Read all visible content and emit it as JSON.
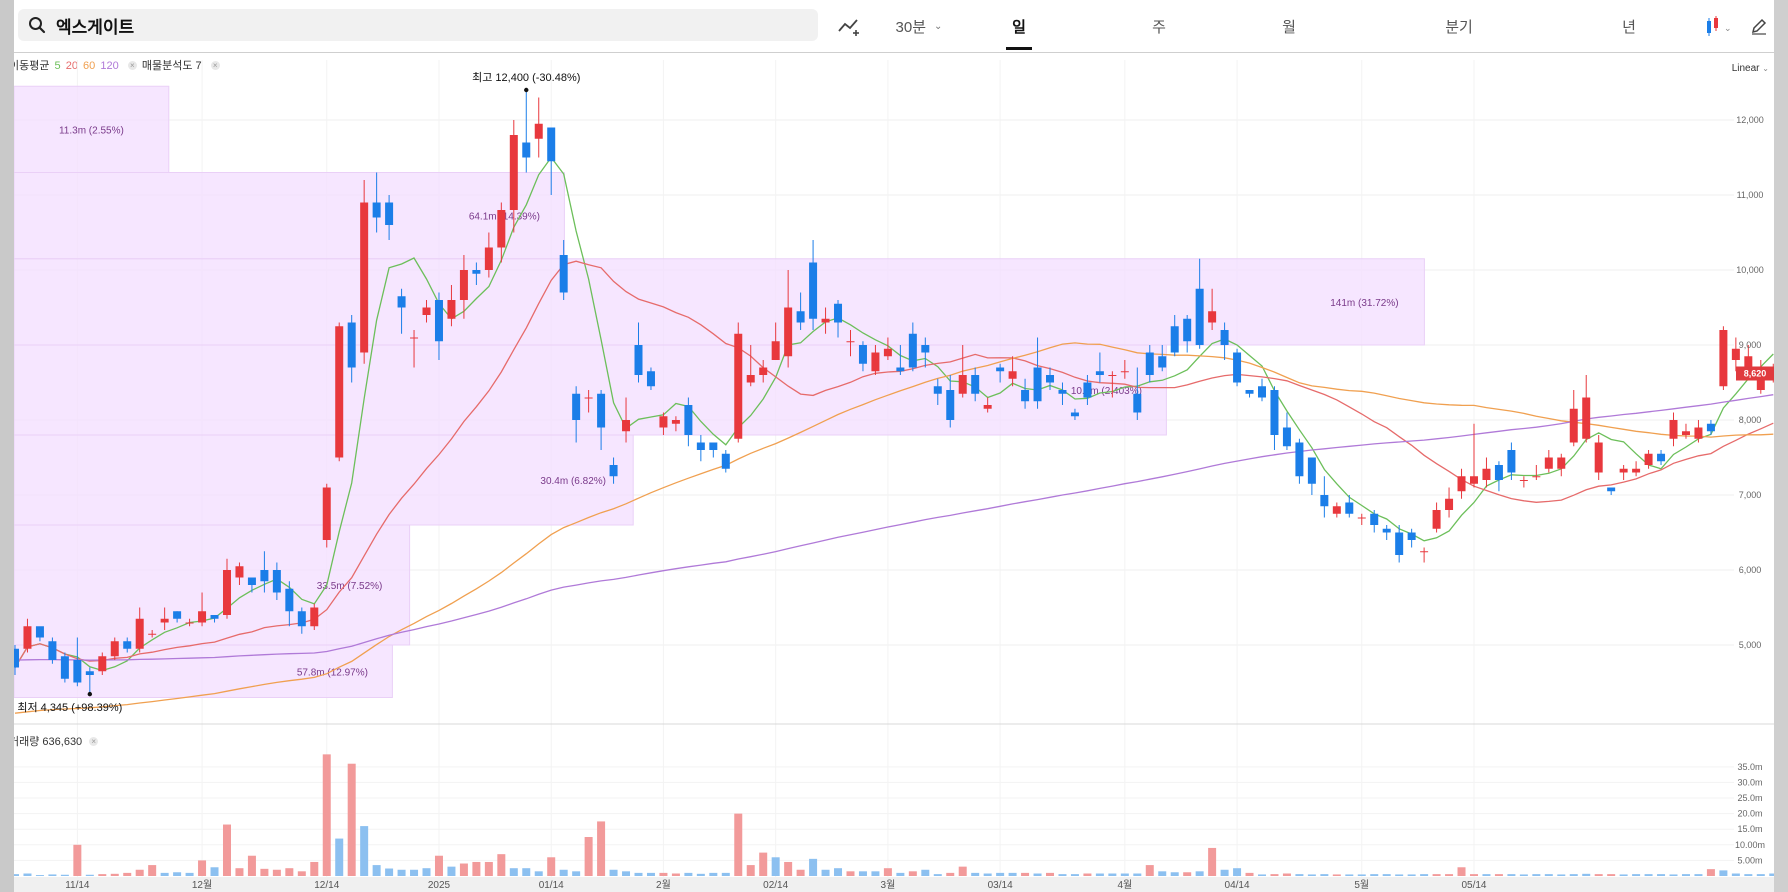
{
  "search": {
    "value": "엑스게이트"
  },
  "toolbar": {
    "interval_label": "30분",
    "tabs": [
      {
        "label": "일",
        "active": true
      },
      {
        "label": "주",
        "active": false
      },
      {
        "label": "월",
        "active": false
      },
      {
        "label": "분기",
        "active": false
      },
      {
        "label": "년",
        "active": false
      }
    ],
    "icons": [
      "search-icon",
      "indicator-icon",
      "candle-type-icon",
      "pencil-icon"
    ]
  },
  "legend": {
    "ma_label": "이동평균",
    "ma_periods": [
      "5",
      "20",
      "60",
      "120"
    ],
    "ma_colors": [
      "#6cbf5a",
      "#e66b6b",
      "#f0a050",
      "#b07ad8"
    ],
    "profile_label": "매물분석도 7"
  },
  "scale_mode": "Linear",
  "price_annotations": {
    "high": {
      "prefix": "최고",
      "value": "12,400",
      "pct": "(-30.48%)"
    },
    "low": {
      "prefix": "최저",
      "value": "4,345",
      "pct": "(+98.39%)"
    },
    "current": "8,620"
  },
  "volume_label": "거래량 636,630",
  "colors": {
    "up": "#e8383d",
    "down": "#1b7ee8",
    "up_vol": "#f29a9a",
    "down_vol": "#8cc0f0",
    "profile": "#f3deff",
    "current_tag": "#e03a3e"
  },
  "chart_data": {
    "type": "candlestick",
    "price_axis": {
      "ticks": [
        "5,000",
        "6,000",
        "7,000",
        "8,000",
        "9,000",
        "10,000",
        "11,000",
        "12,000"
      ],
      "range": [
        4000,
        12800
      ]
    },
    "volume_axis": {
      "ticks": [
        "5.00m",
        "10.00m",
        "15.0m",
        "20.0m",
        "25.0m",
        "30.0m",
        "35.0m"
      ]
    },
    "x_labels": [
      "11/14",
      "12월",
      "12/14",
      "2025",
      "01/14",
      "2월",
      "02/14",
      "3월",
      "03/14",
      "4월",
      "04/14",
      "5월",
      "05/14"
    ],
    "volume_profile": [
      {
        "label": "57.8m (12.97%)",
        "low": 4300,
        "high": 5000,
        "reach": 0.22
      },
      {
        "label": "33.5m (7.52%)",
        "low": 5000,
        "high": 6600,
        "reach": 0.23
      },
      {
        "label": "30.4m (6.82%)",
        "low": 6600,
        "high": 7800,
        "reach": 0.36
      },
      {
        "label": "10.7m (2.403%)",
        "low": 7800,
        "high": 9000,
        "reach": 0.67
      },
      {
        "label": "141m (31.72%)",
        "low": 9000,
        "high": 10150,
        "reach": 0.82
      },
      {
        "label": "64.1m (14.39%)",
        "low": 10150,
        "high": 11300,
        "reach": 0.32
      },
      {
        "label": "11.3m (2.55%)",
        "low": 11300,
        "high": 12450,
        "reach": 0.09
      }
    ],
    "candles": [
      [
        4950,
        4700,
        5000,
        4600
      ],
      [
        4950,
        5250,
        5350,
        4900
      ],
      [
        5250,
        5100,
        5200,
        5050
      ],
      [
        5050,
        4800,
        5100,
        4750
      ],
      [
        4850,
        4550,
        4900,
        4500
      ],
      [
        4800,
        4500,
        5100,
        4450
      ],
      [
        4650,
        4600,
        4700,
        4345
      ],
      [
        4650,
        4850,
        4900,
        4600
      ],
      [
        4850,
        5050,
        5100,
        4800
      ],
      [
        5050,
        4950,
        5100,
        4900
      ],
      [
        4950,
        5350,
        5500,
        4900
      ],
      [
        5150,
        5150,
        5200,
        5100
      ],
      [
        5300,
        5350,
        5500,
        5200
      ],
      [
        5450,
        5350,
        5450,
        5300
      ],
      [
        5300,
        5300,
        5350,
        5250
      ],
      [
        5300,
        5450,
        5700,
        5250
      ],
      [
        5400,
        5350,
        5400,
        5300
      ],
      [
        5400,
        6000,
        6150,
        5350
      ],
      [
        5900,
        6050,
        6100,
        5800
      ],
      [
        5900,
        5800,
        5850,
        5700
      ],
      [
        6000,
        5850,
        6250,
        5700
      ],
      [
        6000,
        5700,
        6100,
        5600
      ],
      [
        5750,
        5450,
        5850,
        5250
      ],
      [
        5450,
        5250,
        5500,
        5150
      ],
      [
        5250,
        5500,
        5550,
        5200
      ],
      [
        6400,
        7100,
        7150,
        6300
      ],
      [
        7500,
        9250,
        9300,
        7450
      ],
      [
        9300,
        8700,
        9400,
        8500
      ],
      [
        8900,
        10900,
        11200,
        8750
      ],
      [
        10900,
        10700,
        11300,
        10500
      ],
      [
        10900,
        10600,
        11000,
        10400
      ],
      [
        9650,
        9500,
        9750,
        9150
      ],
      [
        9100,
        9100,
        9200,
        8700
      ],
      [
        9400,
        9500,
        9600,
        9300
      ],
      [
        9600,
        9050,
        9700,
        8800
      ],
      [
        9350,
        9600,
        9800,
        9250
      ],
      [
        9600,
        10000,
        10200,
        9350
      ],
      [
        10000,
        9950,
        10100,
        9800
      ],
      [
        10000,
        10300,
        10500,
        9900
      ],
      [
        10300,
        10800,
        10900,
        10100
      ],
      [
        10800,
        11800,
        12000,
        10500
      ],
      [
        11700,
        11500,
        12400,
        11300
      ],
      [
        11750,
        11950,
        12300,
        11500
      ],
      [
        11900,
        11450,
        11900,
        11000
      ],
      [
        10200,
        9700,
        10400,
        9600
      ],
      [
        8350,
        8000,
        8450,
        7700
      ],
      [
        8300,
        8300,
        8400,
        8100
      ],
      [
        8350,
        7900,
        8400,
        7600
      ],
      [
        7400,
        7250,
        7500,
        7150
      ],
      [
        7850,
        8000,
        8300,
        7700
      ],
      [
        9000,
        8600,
        9300,
        8500
      ],
      [
        8650,
        8450,
        8700,
        8400
      ],
      [
        7900,
        8050,
        8100,
        7800
      ],
      [
        7950,
        8000,
        8050,
        7850
      ],
      [
        8200,
        7800,
        8300,
        7650
      ],
      [
        7700,
        7600,
        7800,
        7450
      ],
      [
        7700,
        7600,
        7700,
        7500
      ],
      [
        7550,
        7350,
        7600,
        7300
      ],
      [
        7750,
        9150,
        9300,
        7700
      ],
      [
        8500,
        8600,
        9000,
        8450
      ],
      [
        8600,
        8700,
        8800,
        8500
      ],
      [
        8800,
        9050,
        9300,
        8800
      ],
      [
        8850,
        9500,
        10000,
        8700
      ],
      [
        9450,
        9300,
        9700,
        9200
      ],
      [
        10100,
        9350,
        10400,
        9200
      ],
      [
        9300,
        9350,
        9500,
        9150
      ],
      [
        9550,
        9300,
        9600,
        9100
      ],
      [
        9050,
        9050,
        9200,
        8850
      ],
      [
        9000,
        8750,
        9050,
        8650
      ],
      [
        8650,
        8900,
        9000,
        8600
      ],
      [
        8850,
        8950,
        9100,
        8800
      ],
      [
        8700,
        8650,
        9000,
        8600
      ],
      [
        9150,
        8700,
        9300,
        8650
      ],
      [
        9000,
        8900,
        9100,
        8700
      ],
      [
        8450,
        8350,
        8550,
        8200
      ],
      [
        8400,
        8000,
        8600,
        7900
      ],
      [
        8350,
        8600,
        9000,
        8300
      ],
      [
        8600,
        8350,
        8700,
        8250
      ],
      [
        8150,
        8200,
        8300,
        8100
      ],
      [
        8700,
        8650,
        8750,
        8500
      ],
      [
        8550,
        8650,
        8850,
        8450
      ],
      [
        8400,
        8250,
        8550,
        8150
      ],
      [
        8700,
        8250,
        9100,
        8150
      ],
      [
        8600,
        8500,
        8700,
        8400
      ],
      [
        8400,
        8350,
        8500,
        8200
      ],
      [
        8100,
        8050,
        8150,
        8000
      ],
      [
        8500,
        8300,
        8600,
        8200
      ],
      [
        8650,
        8600,
        8900,
        8500
      ],
      [
        8600,
        8600,
        8650,
        8300
      ],
      [
        8650,
        8650,
        8800,
        8550
      ],
      [
        8350,
        8100,
        8700,
        8000
      ],
      [
        8900,
        8600,
        9000,
        8500
      ],
      [
        8850,
        8700,
        9000,
        8650
      ],
      [
        9250,
        8900,
        9400,
        8850
      ],
      [
        9350,
        9050,
        9400,
        8900
      ],
      [
        9750,
        9000,
        10150,
        8950
      ],
      [
        9300,
        9450,
        9750,
        9200
      ],
      [
        9200,
        9000,
        9300,
        8800
      ],
      [
        8900,
        8500,
        8950,
        8450
      ],
      [
        8400,
        8350,
        8400,
        8300
      ],
      [
        8450,
        8300,
        8550,
        8250
      ],
      [
        8400,
        7800,
        8450,
        7600
      ],
      [
        7900,
        7650,
        8100,
        7600
      ],
      [
        7700,
        7250,
        7750,
        7150
      ],
      [
        7500,
        7150,
        7500,
        7000
      ],
      [
        7000,
        6850,
        7250,
        6700
      ],
      [
        6750,
        6850,
        6900,
        6700
      ],
      [
        6900,
        6750,
        7000,
        6700
      ],
      [
        6700,
        6700,
        6750,
        6600
      ],
      [
        6750,
        6600,
        6800,
        6500
      ],
      [
        6550,
        6500,
        6600,
        6400
      ],
      [
        6500,
        6200,
        6600,
        6100
      ],
      [
        6500,
        6400,
        6550,
        6300
      ],
      [
        6250,
        6250,
        6300,
        6100
      ],
      [
        6550,
        6800,
        6900,
        6500
      ],
      [
        6800,
        6950,
        7100,
        6700
      ],
      [
        7050,
        7250,
        7350,
        6950
      ],
      [
        7150,
        7250,
        7950,
        7100
      ],
      [
        7200,
        7350,
        7500,
        7100
      ],
      [
        7400,
        7200,
        7450,
        7050
      ],
      [
        7600,
        7300,
        7700,
        7200
      ],
      [
        7200,
        7200,
        7250,
        7100
      ],
      [
        7250,
        7250,
        7400,
        7200
      ],
      [
        7350,
        7500,
        7600,
        7300
      ],
      [
        7350,
        7500,
        7550,
        7250
      ],
      [
        7700,
        8150,
        8400,
        7650
      ],
      [
        7750,
        8300,
        8600,
        7700
      ],
      [
        7300,
        7700,
        7800,
        7200
      ],
      [
        7100,
        7050,
        7100,
        7000
      ],
      [
        7300,
        7350,
        7400,
        7200
      ],
      [
        7300,
        7350,
        7450,
        7250
      ],
      [
        7400,
        7550,
        7600,
        7350
      ],
      [
        7550,
        7450,
        7600,
        7400
      ],
      [
        7750,
        8000,
        8100,
        7650
      ],
      [
        7800,
        7850,
        7950,
        7750
      ],
      [
        7750,
        7900,
        8000,
        7700
      ],
      [
        7950,
        7850,
        8000,
        7800
      ],
      [
        8450,
        9200,
        9250,
        8400
      ],
      [
        8800,
        8950,
        9100,
        8650
      ],
      [
        8650,
        8850,
        9000,
        8600
      ],
      [
        8400,
        8700,
        8800,
        8350
      ],
      [
        8550,
        8700,
        8750,
        8500
      ]
    ],
    "volumes": [
      [
        0.6,
        0
      ],
      [
        0.8,
        0
      ],
      [
        0.3,
        0
      ],
      [
        0.5,
        0
      ],
      [
        0.4,
        0
      ],
      [
        10.0,
        1
      ],
      [
        0.4,
        0
      ],
      [
        0.6,
        1
      ],
      [
        0.7,
        1
      ],
      [
        1.0,
        1
      ],
      [
        2.0,
        1
      ],
      [
        3.5,
        1
      ],
      [
        1.0,
        0
      ],
      [
        1.2,
        0
      ],
      [
        1.0,
        0
      ],
      [
        5.0,
        1
      ],
      [
        2.8,
        0
      ],
      [
        16.5,
        1
      ],
      [
        2.5,
        1
      ],
      [
        6.5,
        1
      ],
      [
        2.3,
        1
      ],
      [
        2.0,
        1
      ],
      [
        2.5,
        1
      ],
      [
        1.5,
        1
      ],
      [
        4.5,
        1
      ],
      [
        39.0,
        1
      ],
      [
        12.0,
        0
      ],
      [
        36.0,
        1
      ],
      [
        16.0,
        0
      ],
      [
        3.5,
        0
      ],
      [
        2.4,
        0
      ],
      [
        2.0,
        0
      ],
      [
        2.0,
        0
      ],
      [
        2.5,
        0
      ],
      [
        6.5,
        1
      ],
      [
        3.0,
        0
      ],
      [
        4.0,
        1
      ],
      [
        4.5,
        1
      ],
      [
        4.5,
        1
      ],
      [
        7.0,
        1
      ],
      [
        2.5,
        0
      ],
      [
        2.5,
        0
      ],
      [
        1.5,
        0
      ],
      [
        6.0,
        1
      ],
      [
        2.0,
        0
      ],
      [
        1.5,
        0
      ],
      [
        12.5,
        1
      ],
      [
        17.5,
        1
      ],
      [
        2.0,
        0
      ],
      [
        1.5,
        0
      ],
      [
        1.0,
        0
      ],
      [
        1.0,
        0
      ],
      [
        1.0,
        1
      ],
      [
        0.8,
        1
      ],
      [
        1.0,
        0
      ],
      [
        0.7,
        0
      ],
      [
        1.0,
        0
      ],
      [
        1.0,
        0
      ],
      [
        20.0,
        1
      ],
      [
        3.5,
        1
      ],
      [
        7.5,
        1
      ],
      [
        6.0,
        0
      ],
      [
        4.5,
        1
      ],
      [
        2.0,
        1
      ],
      [
        5.5,
        0
      ],
      [
        2.0,
        0
      ],
      [
        2.5,
        0
      ],
      [
        1.5,
        1
      ],
      [
        1.5,
        0
      ],
      [
        1.5,
        0
      ],
      [
        2.5,
        1
      ],
      [
        1.0,
        0
      ],
      [
        1.5,
        1
      ],
      [
        2.0,
        0
      ],
      [
        0.6,
        0
      ],
      [
        1.0,
        1
      ],
      [
        3.0,
        1
      ],
      [
        1.0,
        0
      ],
      [
        0.8,
        0
      ],
      [
        1.0,
        0
      ],
      [
        1.0,
        0
      ],
      [
        1.0,
        1
      ],
      [
        0.8,
        0
      ],
      [
        1.0,
        1
      ],
      [
        0.6,
        0
      ],
      [
        0.6,
        0
      ],
      [
        0.8,
        1
      ],
      [
        0.8,
        0
      ],
      [
        0.8,
        0
      ],
      [
        0.8,
        0
      ],
      [
        0.8,
        0
      ],
      [
        3.5,
        1
      ],
      [
        1.5,
        0
      ],
      [
        1.2,
        0
      ],
      [
        1.2,
        1
      ],
      [
        1.5,
        0
      ],
      [
        9.0,
        1
      ],
      [
        2.0,
        0
      ],
      [
        2.5,
        0
      ],
      [
        1.0,
        1
      ],
      [
        0.5,
        0
      ],
      [
        0.6,
        1
      ],
      [
        0.8,
        1
      ],
      [
        0.6,
        0
      ],
      [
        0.5,
        0
      ],
      [
        0.6,
        0
      ],
      [
        0.5,
        1
      ],
      [
        0.5,
        0
      ],
      [
        0.5,
        0
      ],
      [
        0.6,
        0
      ],
      [
        0.6,
        0
      ],
      [
        0.5,
        0
      ],
      [
        0.5,
        0
      ],
      [
        0.6,
        0
      ],
      [
        0.6,
        1
      ],
      [
        0.6,
        1
      ],
      [
        2.8,
        1
      ],
      [
        0.6,
        1
      ],
      [
        0.6,
        0
      ],
      [
        0.6,
        1
      ],
      [
        0.6,
        0
      ],
      [
        0.5,
        0
      ],
      [
        0.6,
        0
      ],
      [
        0.6,
        0
      ],
      [
        0.5,
        0
      ],
      [
        0.6,
        0
      ],
      [
        0.7,
        0
      ],
      [
        0.6,
        1
      ],
      [
        0.6,
        1
      ],
      [
        0.5,
        0
      ],
      [
        0.6,
        0
      ],
      [
        0.6,
        0
      ],
      [
        0.6,
        0
      ],
      [
        0.5,
        0
      ],
      [
        0.6,
        0
      ],
      [
        0.6,
        0
      ],
      [
        2.2,
        1
      ],
      [
        1.8,
        0
      ],
      [
        0.8,
        0
      ],
      [
        0.6,
        0
      ],
      [
        0.6,
        0
      ],
      [
        0.8,
        0
      ]
    ]
  }
}
